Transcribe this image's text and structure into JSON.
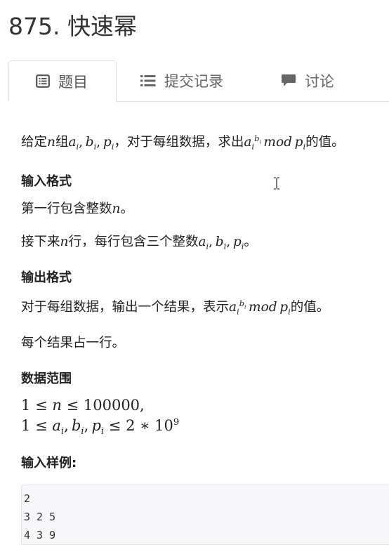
{
  "problem": {
    "title": "875. 快速幂"
  },
  "tabs": [
    {
      "label": "题目",
      "icon": "list-icon",
      "active": true
    },
    {
      "label": "提交记录",
      "icon": "list-bullets-icon",
      "active": false
    },
    {
      "label": "讨论",
      "icon": "comment-icon",
      "active": false
    }
  ],
  "description": {
    "pre": "给定",
    "n": "n",
    "mid": "组",
    "a": "a",
    "i": "i",
    "comma": ",",
    "b": "b",
    "p": "p",
    "post": "，对于每组数据，求出",
    "mod": "mod",
    "end": "的值。"
  },
  "input_format": {
    "heading": "输入格式",
    "line1_pre": "第一行包含整数",
    "line1_var": "n",
    "line1_end": "。",
    "line2_pre": "接下来",
    "line2_var": "n",
    "line2_mid": "行，每行包含三个整数",
    "line2_end": "。"
  },
  "output_format": {
    "heading": "输出格式",
    "line1_pre": "对于每组数据，输出一个结果，表示",
    "line1_end": "的值。",
    "line2": "每个结果占一行。"
  },
  "data_range": {
    "heading": "数据范围",
    "line1_one": "1",
    "leq": "≤",
    "line1_n": "n",
    "line1_max": "100000",
    "line1_end": ",",
    "line2_rhs": "2",
    "times": "∗",
    "ten": "10",
    "exp": "9"
  },
  "sample": {
    "heading": "输入样例:",
    "lines": [
      "2",
      "3 2 5",
      "4 3 9"
    ]
  }
}
